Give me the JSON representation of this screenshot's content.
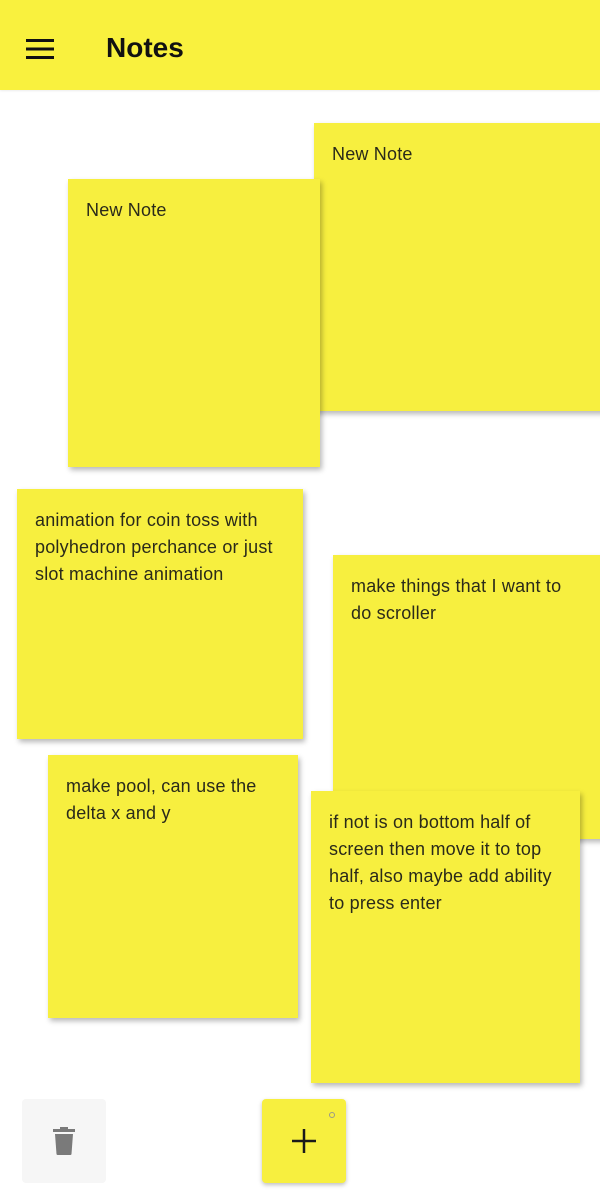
{
  "appbar": {
    "title": "Notes",
    "menu_icon": "hamburger-menu-icon",
    "background": "#f9f13e"
  },
  "notes": [
    {
      "id": "note-1",
      "text": "New Note"
    },
    {
      "id": "note-2",
      "text": "New Note"
    },
    {
      "id": "note-3",
      "text": "animation for coin toss with polyhedron perchance or just slot machine animation"
    },
    {
      "id": "note-4",
      "text": "make things that I want to do scroller"
    },
    {
      "id": "note-5",
      "text": "make pool, can use the delta x and y"
    },
    {
      "id": "note-6",
      "text": "if not is on bottom half of screen then move it to top half, also maybe add ability to press enter"
    }
  ],
  "actions": {
    "delete_icon": "trash-icon",
    "add_icon": "plus-icon",
    "add_label": "+"
  },
  "colors": {
    "note": "#f7ef3f",
    "accent": "#f9f13e",
    "delete_bg": "#f6f6f6",
    "icon_gray": "#7a7a7a"
  }
}
